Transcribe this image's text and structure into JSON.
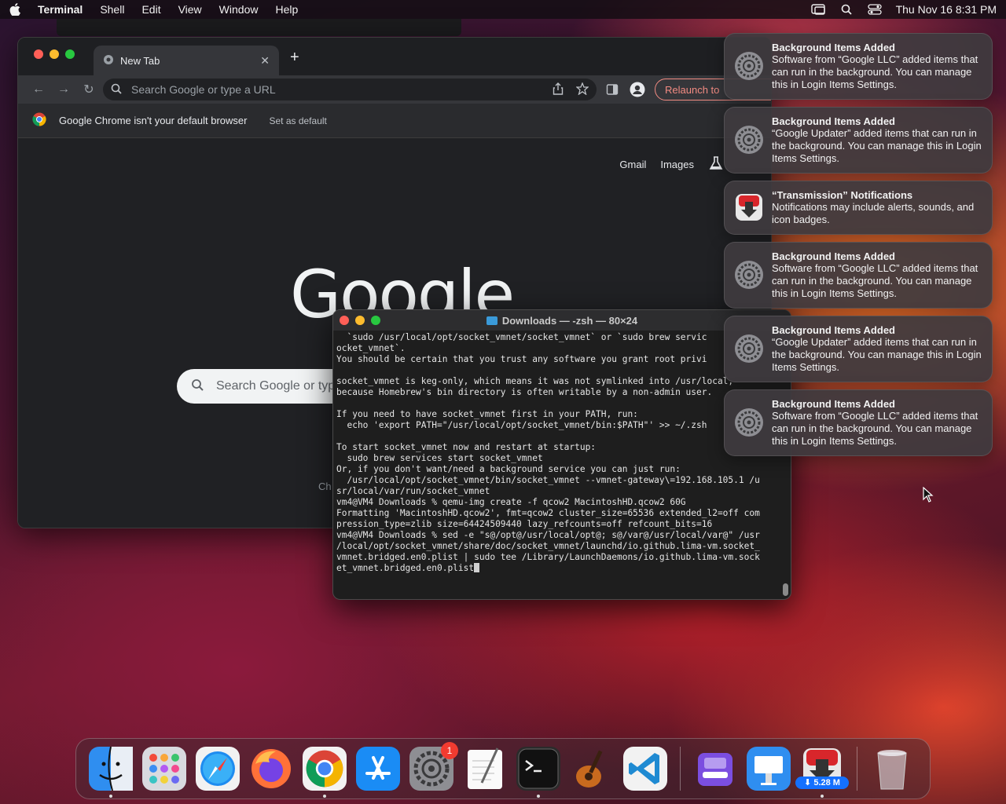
{
  "menubar": {
    "app_name": "Terminal",
    "items": [
      "Shell",
      "Edit",
      "View",
      "Window",
      "Help"
    ],
    "datetime": "Thu Nov 16  8:31 PM"
  },
  "chrome": {
    "tab_title": "New Tab",
    "omnibox_placeholder": "Search Google or type a URL",
    "relaunch_label": "Relaunch to",
    "infobar_message": "Google Chrome isn't your default browser",
    "infobar_action": "Set as default",
    "gmail": "Gmail",
    "images": "Images",
    "logo": "Google",
    "ntp_search_placeholder": "Search Google or typ",
    "shortcut_partial": "Ch"
  },
  "terminal": {
    "title": "Downloads — -zsh — 80×24",
    "lines": [
      "  `sudo /usr/local/opt/socket_vmnet/socket_vmnet` or `sudo brew servic",
      "ocket_vmnet`.",
      "You should be certain that you trust any software you grant root privi",
      "",
      "socket_vmnet is keg-only, which means it was not symlinked into /usr/local,",
      "because Homebrew's bin directory is often writable by a non-admin user.",
      "",
      "If you need to have socket_vmnet first in your PATH, run:",
      "  echo 'export PATH=\"/usr/local/opt/socket_vmnet/bin:$PATH\"' >> ~/.zsh",
      "",
      "To start socket_vmnet now and restart at startup:",
      "  sudo brew services start socket_vmnet",
      "Or, if you don't want/need a background service you can just run:",
      "  /usr/local/opt/socket_vmnet/bin/socket_vmnet --vmnet-gateway\\=192.168.105.1 /u",
      "sr/local/var/run/socket_vmnet",
      "vm4@VM4 Downloads % qemu-img create -f qcow2 MacintoshHD.qcow2 60G",
      "Formatting 'MacintoshHD.qcow2', fmt=qcow2 cluster_size=65536 extended_l2=off com",
      "pression_type=zlib size=64424509440 lazy_refcounts=off refcount_bits=16",
      "vm4@VM4 Downloads % sed -e \"s@/opt@/usr/local/opt@; s@/var@/usr/local/var@\" /usr",
      "/local/opt/socket_vmnet/share/doc/socket_vmnet/launchd/io.github.lima-vm.socket_",
      "vmnet.bridged.en0.plist | sudo tee /Library/LaunchDaemons/io.github.lima-vm.sock",
      "et_vmnet.bridged.en0.plist"
    ]
  },
  "notifications": [
    {
      "icon": "system-settings-icon",
      "title": "Background Items Added",
      "body": "Software from “Google LLC” added items that can run in the background. You can manage this in Login Items Settings."
    },
    {
      "icon": "system-settings-icon",
      "title": "Background Items Added",
      "body": "“Google Updater” added items that can run in the background. You can manage this in Login Items Settings."
    },
    {
      "icon": "transmission-icon",
      "title": "“Transmission” Notifications",
      "body": "Notifications may include alerts, sounds, and icon badges."
    },
    {
      "icon": "system-settings-icon",
      "title": "Background Items Added",
      "body": "Software from “Google LLC” added items that can run in the background. You can manage this in Login Items Settings."
    },
    {
      "icon": "system-settings-icon",
      "title": "Background Items Added",
      "body": "“Google Updater” added items that can run in the background. You can manage this in Login Items Settings."
    },
    {
      "icon": "system-settings-icon",
      "title": "Background Items Added",
      "body": "Software from “Google LLC” added items that can run in the background. You can manage this in Login Items Settings."
    }
  ],
  "dock": {
    "settings_badge": "1",
    "transmission_label": "⬇ 5.28 M"
  }
}
